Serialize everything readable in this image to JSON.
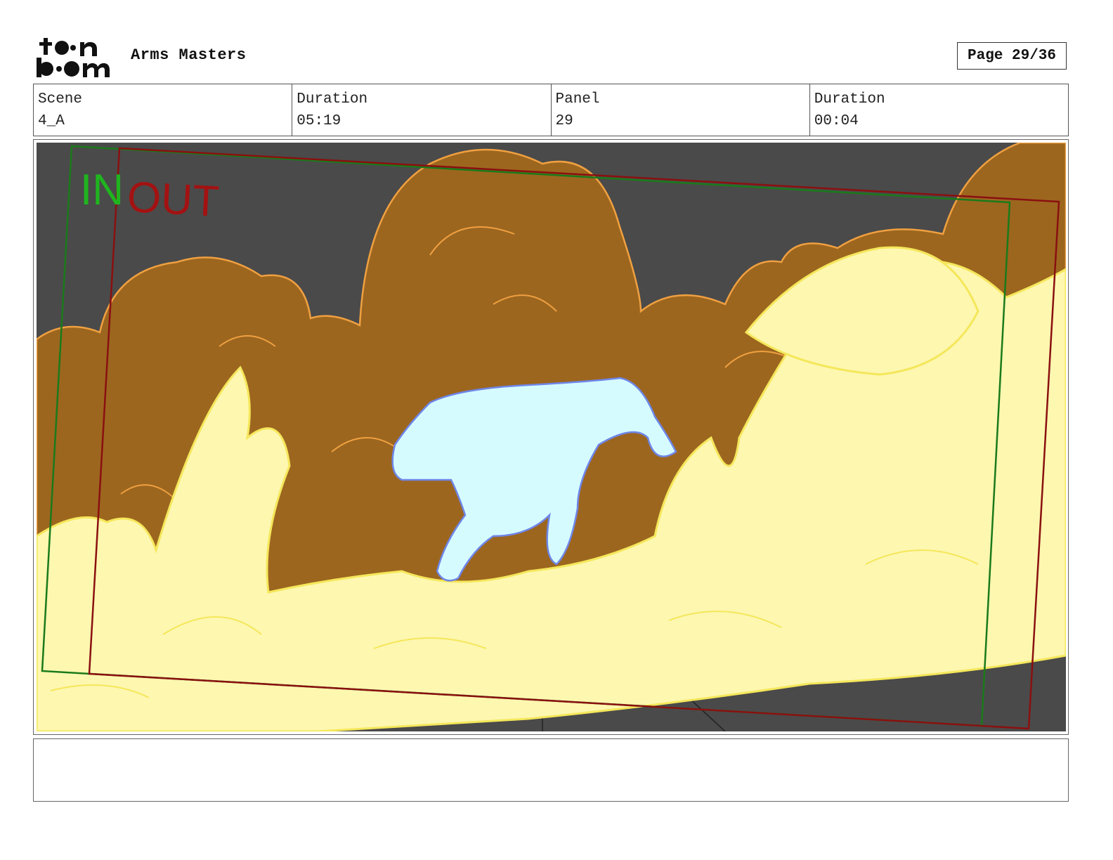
{
  "header": {
    "logo_top": "toon",
    "logo_bottom": "boom",
    "project_title": "Arms Masters",
    "page_label": "Page 29/36"
  },
  "info": {
    "scene_label": "Scene",
    "scene_value": "4_A",
    "duration_label": "Duration",
    "duration_value": "05:19",
    "panel_label": "Panel",
    "panel_value": "29",
    "panel_duration_label": "Duration",
    "panel_duration_value": "00:04"
  },
  "panel": {
    "in_label": "IN",
    "out_label": "OUT",
    "colors": {
      "background": "#4a4a4a",
      "smoke": "#9c661f",
      "smoke_line": "#f0a040",
      "fire": "#fdf7b0",
      "fire_line": "#f5e75a",
      "figure": "#d6fbff",
      "figure_line": "#6f86e8",
      "in_frame": "#1a7a1a",
      "out_frame": "#8a1010"
    }
  },
  "notes": {
    "text": ""
  }
}
